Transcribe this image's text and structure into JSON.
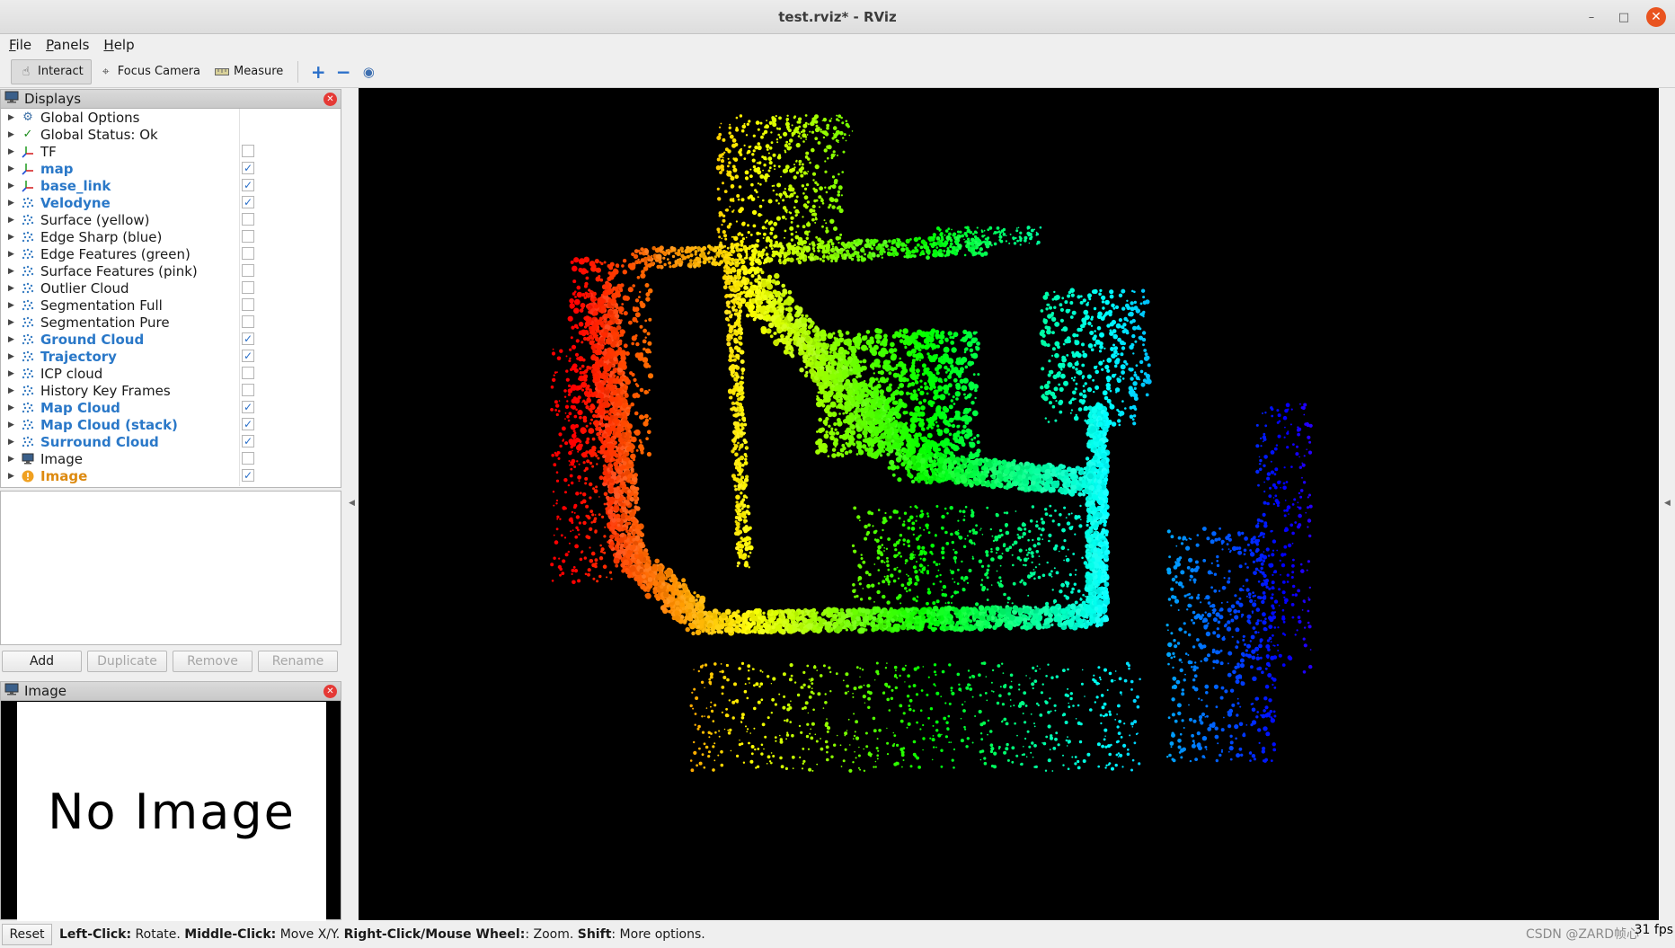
{
  "window": {
    "title": "test.rviz* - RViz"
  },
  "menubar": [
    {
      "label": "File",
      "mnemonic": "F",
      "rest": "ile"
    },
    {
      "label": "Panels",
      "mnemonic": "P",
      "rest": "anels"
    },
    {
      "label": "Help",
      "mnemonic": "H",
      "rest": "elp"
    }
  ],
  "toolbar": {
    "interact": "Interact",
    "focus_camera": "Focus Camera",
    "measure": "Measure"
  },
  "displays_panel": {
    "title": "Displays",
    "items": [
      {
        "label": "Global Options",
        "icon": "gear-icon",
        "checkbox": null,
        "style": "normal"
      },
      {
        "label": "Global Status: Ok",
        "icon": "check-icon",
        "checkbox": null,
        "style": "normal"
      },
      {
        "label": "TF",
        "icon": "axes-icon",
        "checkbox": false,
        "style": "normal"
      },
      {
        "label": "map",
        "icon": "axes-icon",
        "checkbox": true,
        "style": "bold"
      },
      {
        "label": "base_link",
        "icon": "axes-icon",
        "checkbox": true,
        "style": "bold"
      },
      {
        "label": "Velodyne",
        "icon": "pointcloud-icon",
        "checkbox": true,
        "style": "bold"
      },
      {
        "label": "Surface (yellow)",
        "icon": "pointcloud-icon",
        "checkbox": false,
        "style": "normal"
      },
      {
        "label": "Edge Sharp (blue)",
        "icon": "pointcloud-icon",
        "checkbox": false,
        "style": "normal"
      },
      {
        "label": "Edge Features (green)",
        "icon": "pointcloud-icon",
        "checkbox": false,
        "style": "normal"
      },
      {
        "label": "Surface Features (pink)",
        "icon": "pointcloud-icon",
        "checkbox": false,
        "style": "normal"
      },
      {
        "label": "Outlier Cloud",
        "icon": "pointcloud-icon",
        "checkbox": false,
        "style": "normal"
      },
      {
        "label": "Segmentation Full",
        "icon": "pointcloud-icon",
        "checkbox": false,
        "style": "normal"
      },
      {
        "label": "Segmentation Pure",
        "icon": "pointcloud-icon",
        "checkbox": false,
        "style": "normal"
      },
      {
        "label": "Ground Cloud",
        "icon": "pointcloud-icon",
        "checkbox": true,
        "style": "bold"
      },
      {
        "label": "Trajectory",
        "icon": "pointcloud-icon",
        "checkbox": true,
        "style": "bold"
      },
      {
        "label": "ICP cloud",
        "icon": "pointcloud-icon",
        "checkbox": false,
        "style": "normal"
      },
      {
        "label": "History Key Frames",
        "icon": "pointcloud-icon",
        "checkbox": false,
        "style": "normal"
      },
      {
        "label": "Map Cloud",
        "icon": "pointcloud-icon",
        "checkbox": true,
        "style": "bold"
      },
      {
        "label": "Map Cloud (stack)",
        "icon": "pointcloud-icon",
        "checkbox": true,
        "style": "bold"
      },
      {
        "label": "Surround Cloud",
        "icon": "pointcloud-icon",
        "checkbox": true,
        "style": "bold"
      },
      {
        "label": "Image",
        "icon": "monitor-icon",
        "checkbox": false,
        "style": "normal"
      },
      {
        "label": "Image",
        "icon": "warning-icon",
        "checkbox": true,
        "style": "orange"
      }
    ],
    "buttons": {
      "add": "Add",
      "duplicate": "Duplicate",
      "remove": "Remove",
      "rename": "Rename"
    }
  },
  "image_panel": {
    "title": "Image",
    "placeholder": "No Image"
  },
  "statusbar": {
    "reset": "Reset",
    "hint_left_click_key": "Left-Click:",
    "hint_left_click_val": " Rotate. ",
    "hint_middle_click_key": "Middle-Click:",
    "hint_middle_click_val": " Move X/Y. ",
    "hint_right_click_key": "Right-Click/Mouse Wheel:",
    "hint_right_click_val": ": Zoom. ",
    "hint_shift_key": "Shift",
    "hint_shift_val": ": More options.",
    "fps": "31 fps",
    "watermark": "CSDN @ZARD帧心"
  },
  "colors": {
    "accent_blue": "#2a78c8",
    "warning_orange": "#dd8a10",
    "viewport_bg": "#000000"
  }
}
